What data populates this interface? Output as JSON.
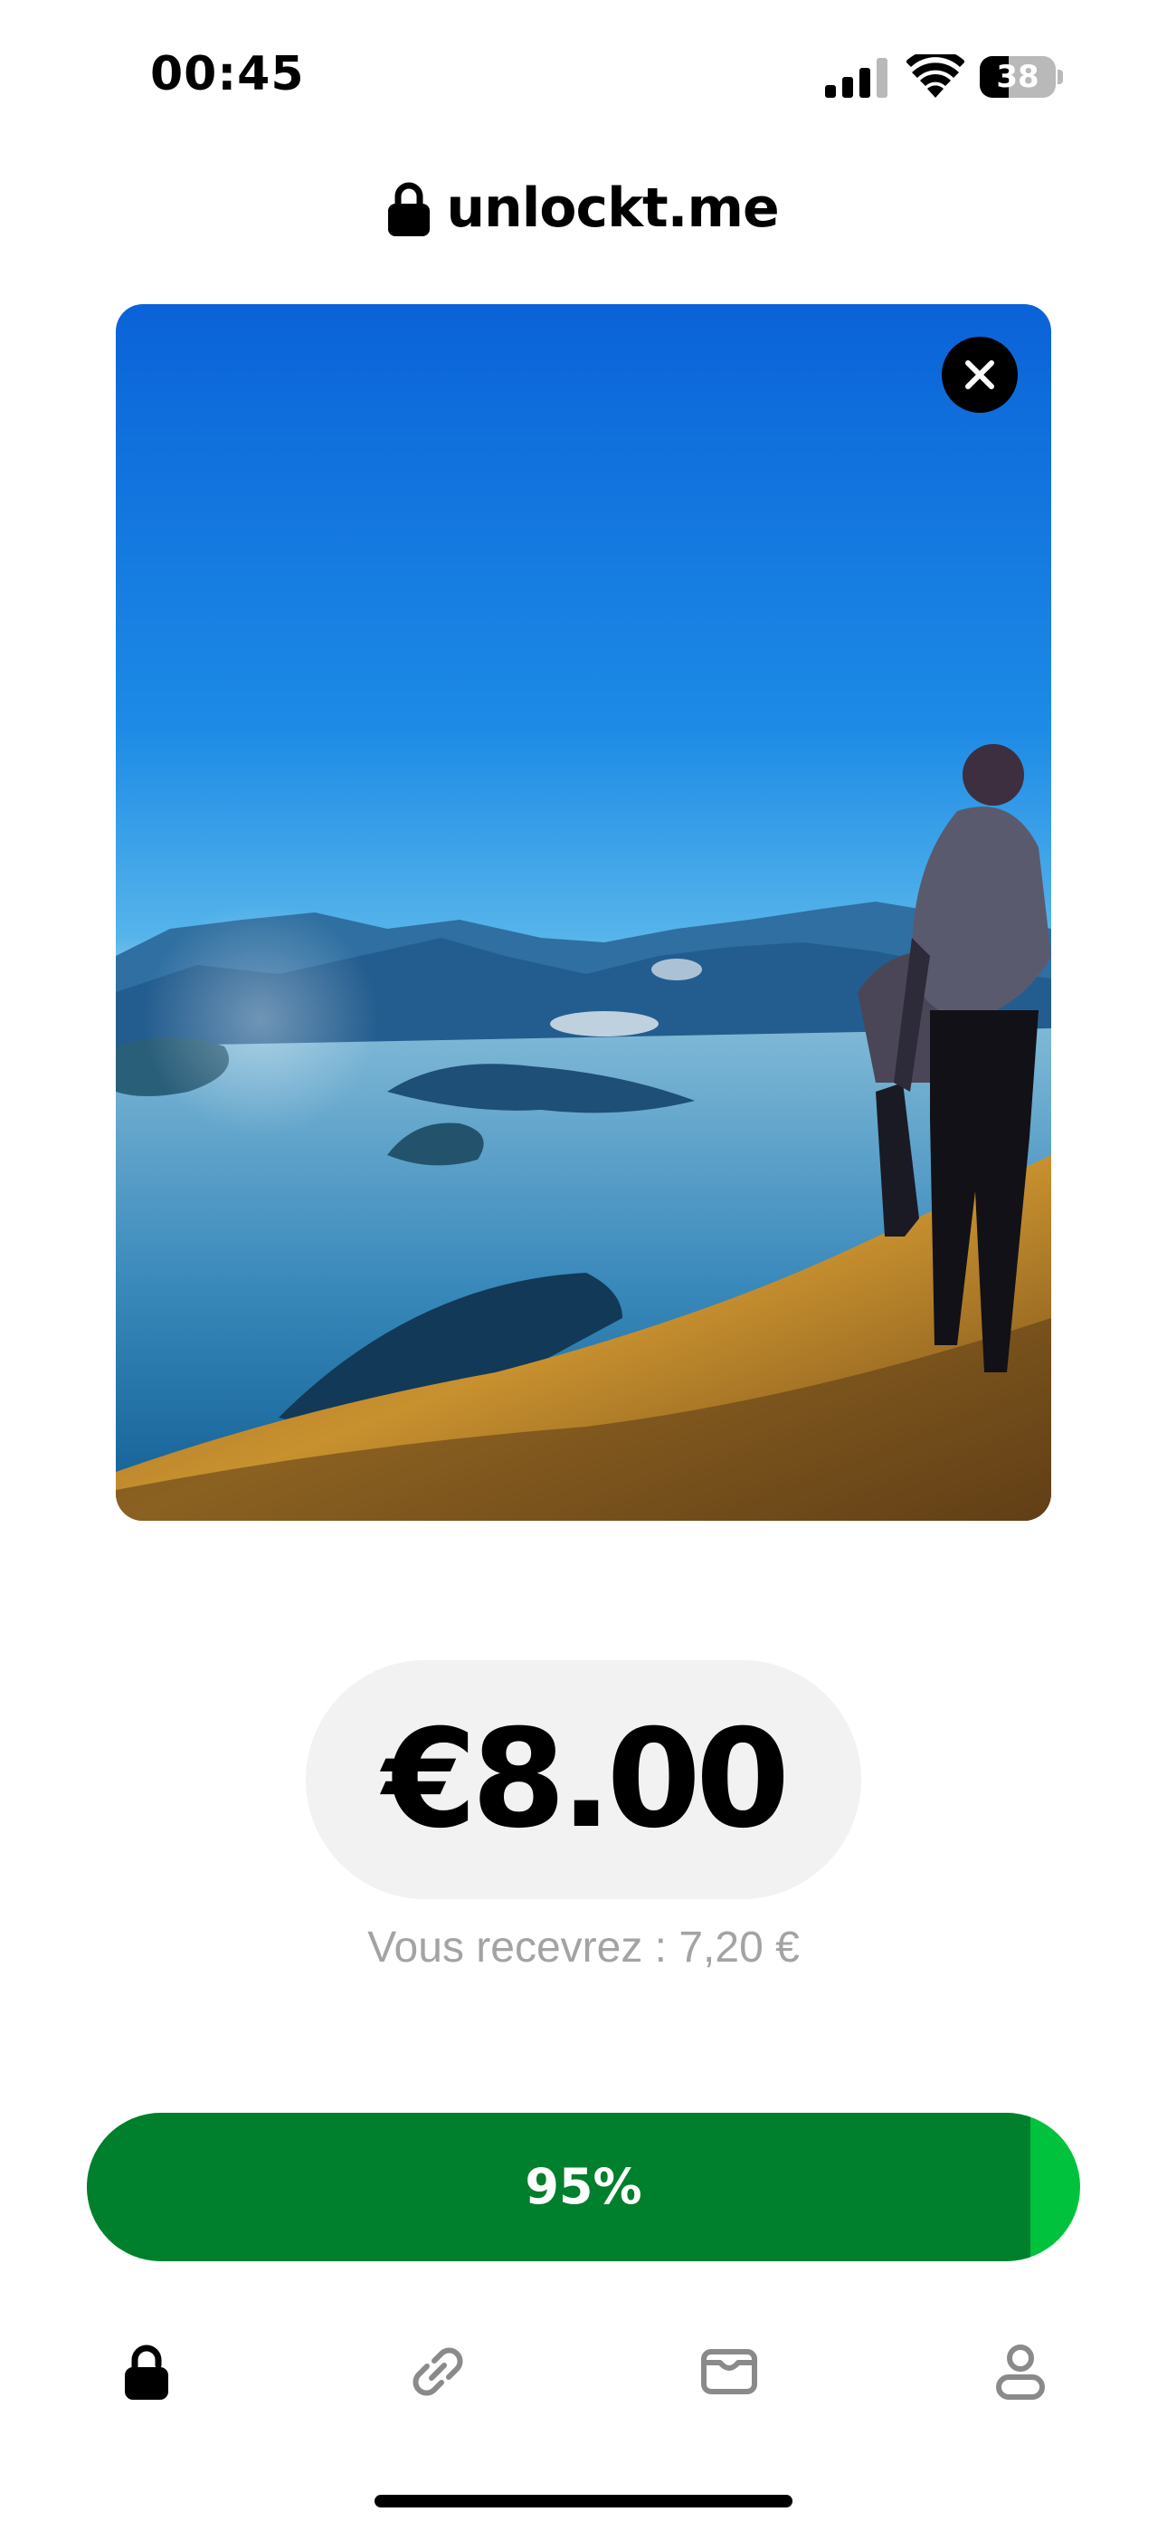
{
  "status_bar": {
    "time": "00:45",
    "battery_level": "38",
    "battery_fraction": 0.38,
    "icons": [
      "signal-icon",
      "wifi-icon",
      "battery-icon"
    ]
  },
  "header": {
    "icon": "lock-icon",
    "site": "unlockt.me"
  },
  "media": {
    "description_icon": "landscape-photo",
    "close_icon": "close-icon"
  },
  "price": {
    "amount": "€8.00",
    "receive_note": "Vous recevrez : 7,20 €"
  },
  "progress": {
    "label": "95%",
    "value": 0.95,
    "fill_color": "#007f2c",
    "track_color": "#00c23d"
  },
  "nav": {
    "items": [
      {
        "icon": "lock-icon",
        "active": true
      },
      {
        "icon": "link-icon",
        "active": false
      },
      {
        "icon": "wallet-icon",
        "active": false
      },
      {
        "icon": "user-icon",
        "active": false
      }
    ],
    "active_color": "#000000",
    "inactive_color": "#8a8a8a"
  }
}
